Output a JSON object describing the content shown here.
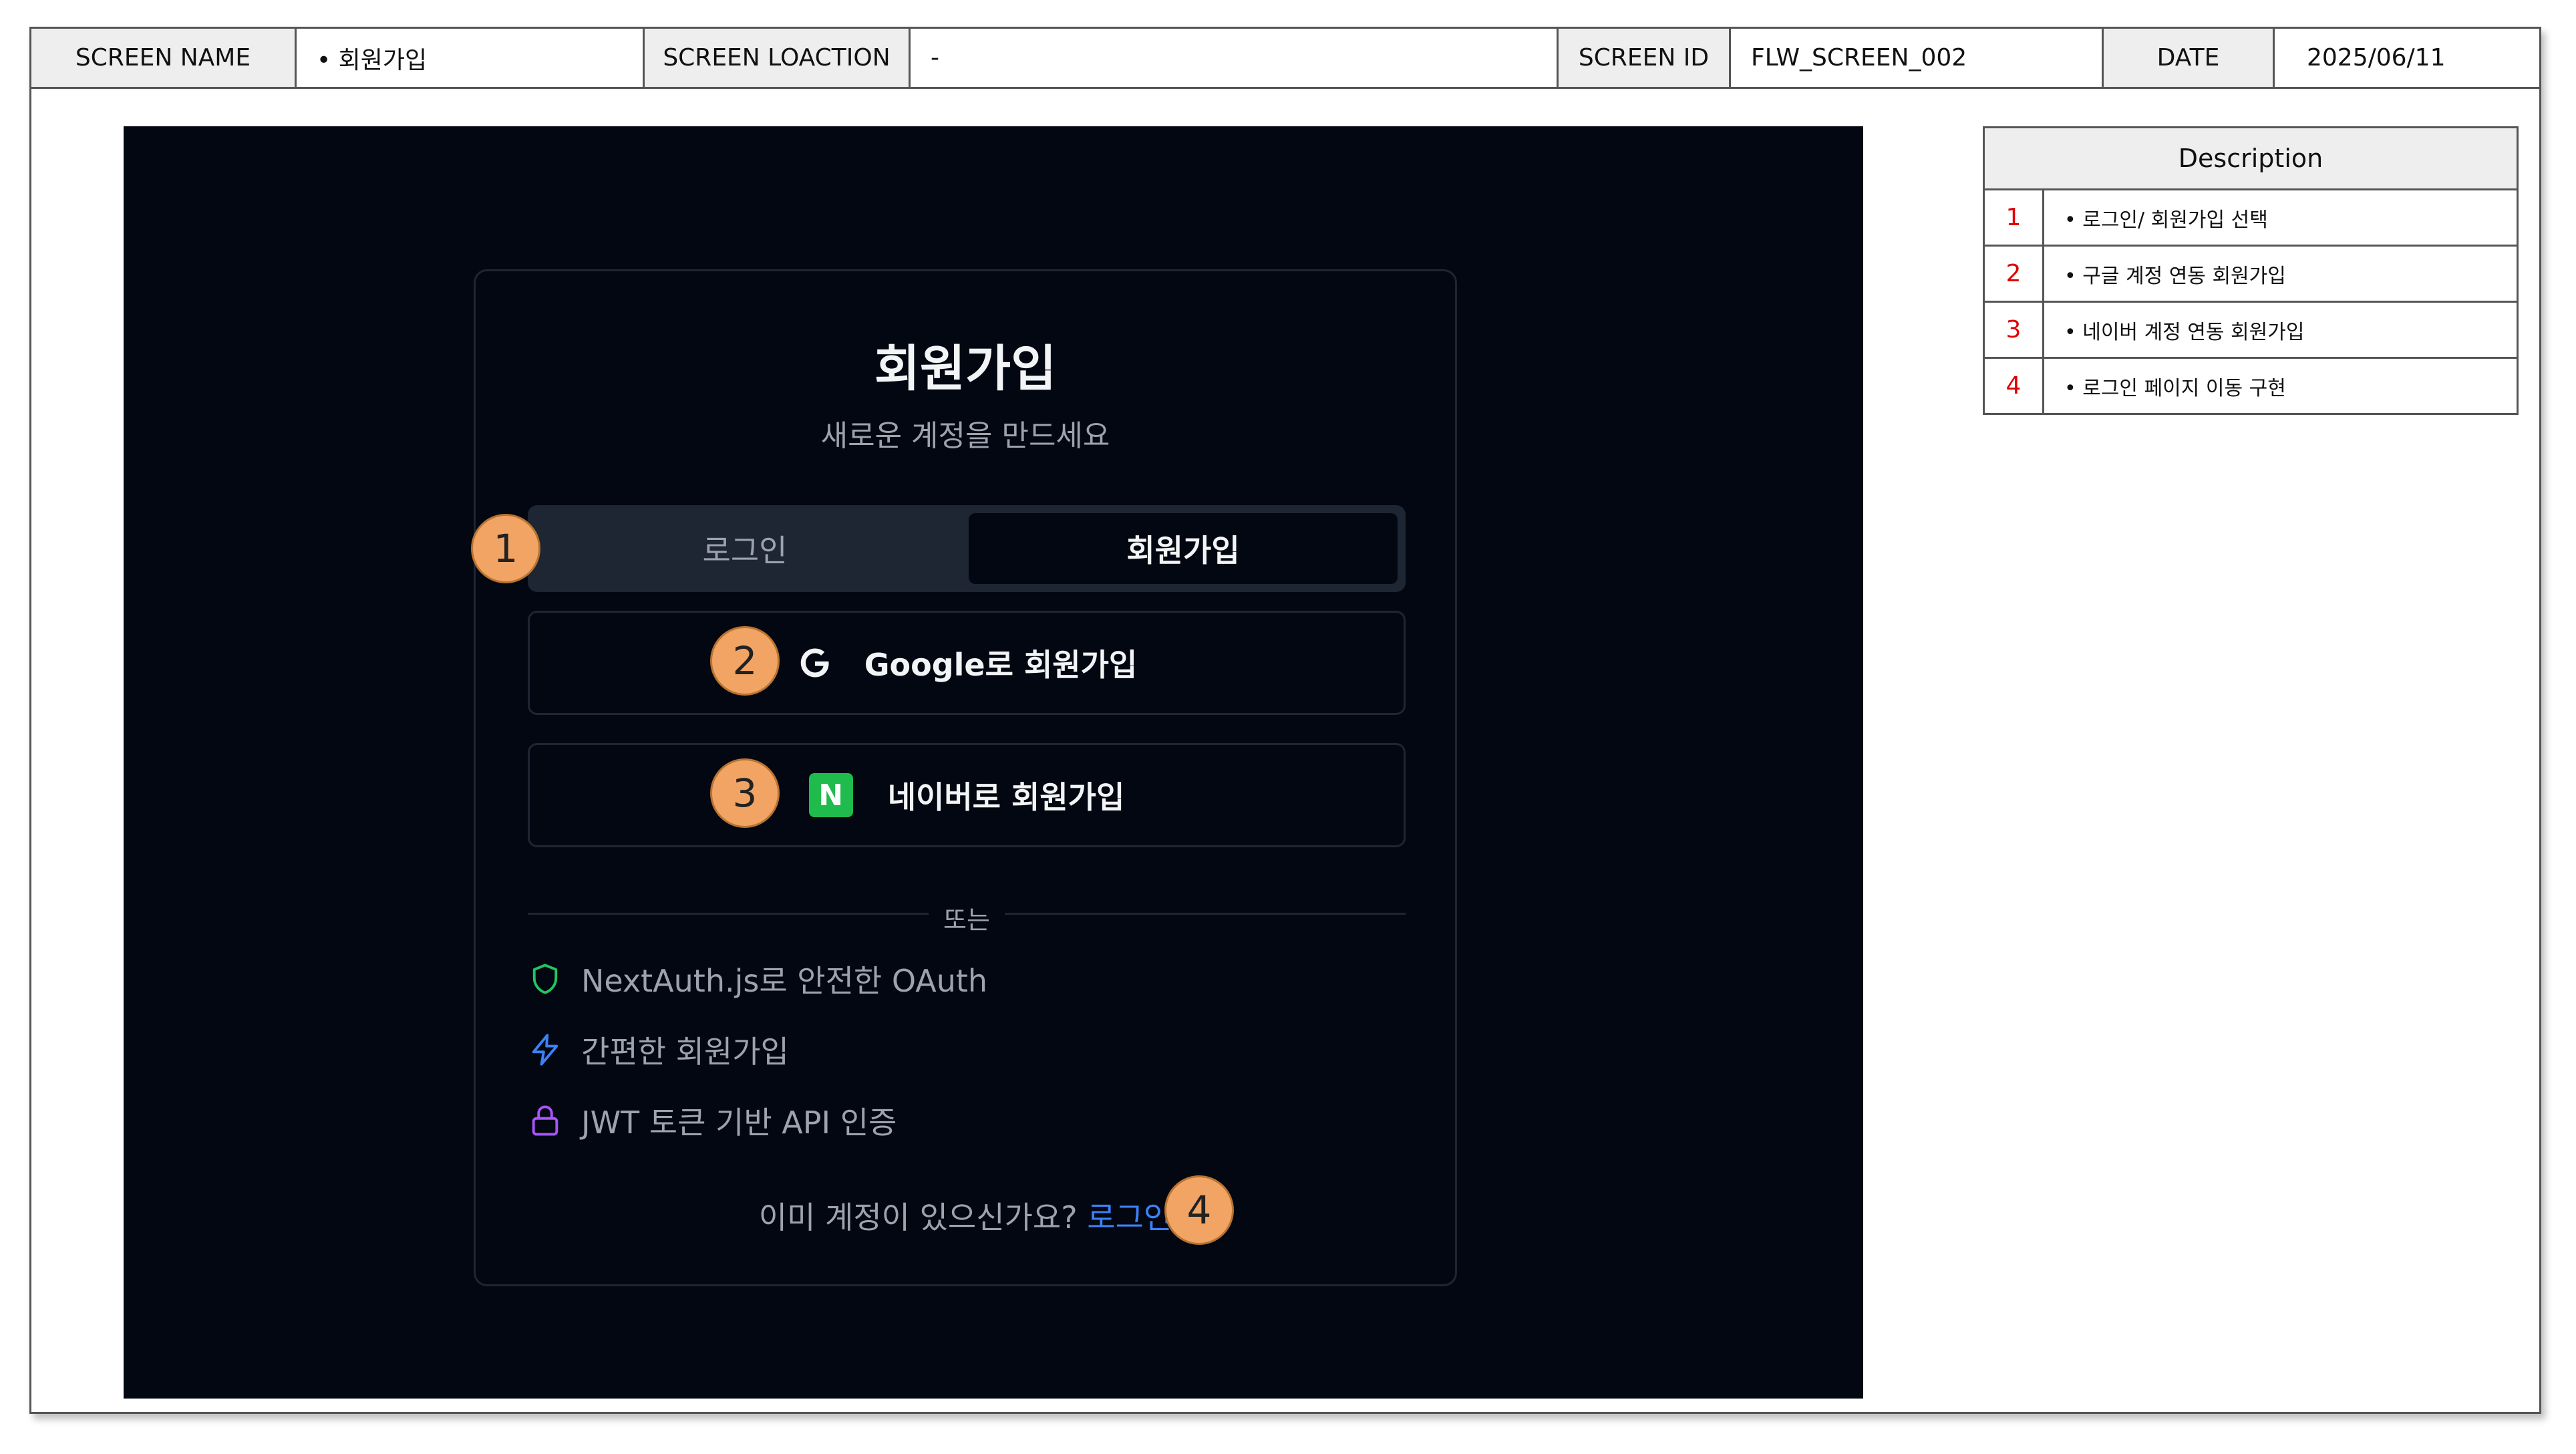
{
  "header": {
    "screen_name_label": "SCREEN NAME",
    "screen_name_value": "• 회원가입",
    "screen_location_label": "SCREEN LOACTION",
    "screen_location_value": "-",
    "screen_id_label": "SCREEN ID",
    "screen_id_value": "FLW_SCREEN_002",
    "date_label": "DATE",
    "date_value": "2025/06/11"
  },
  "app": {
    "title": "회원가입",
    "subtitle": "새로운 계정을 만드세요",
    "tabs": {
      "login": "로그인",
      "signup": "회원가입"
    },
    "google_button": "Google로 회원가입",
    "naver_icon_letter": "N",
    "naver_button": "네이버로 회원가입",
    "divider": "또는",
    "features": [
      {
        "icon": "shield-icon",
        "text": "NextAuth.js로 안전한 OAuth",
        "color": "#22c55e"
      },
      {
        "icon": "lightning-icon",
        "text": "간편한 회원가입",
        "color": "#3b82f6"
      },
      {
        "icon": "lock-icon",
        "text": "JWT 토큰 기반 API 인증",
        "color": "#a855f7"
      }
    ],
    "footer_text": "이미 계정이 있으신가요? ",
    "footer_link": "로그인"
  },
  "markers": [
    "1",
    "2",
    "3",
    "4"
  ],
  "description": {
    "title": "Description",
    "rows": [
      {
        "num": "1",
        "text": "•  로그인/ 회원가입 선택"
      },
      {
        "num": "2",
        "text": "•  구글 계정 연동 회원가입"
      },
      {
        "num": "3",
        "text": "•  네이버 계정 연동 회원가입"
      },
      {
        "num": "4",
        "text": "•  로그인 페이지 이동 구현"
      }
    ]
  },
  "colors": {
    "app_bg": "#030712",
    "marker": "#f2a465",
    "link": "#3b82f6",
    "naver_green": "#1fbb4c",
    "desc_number": "#e00000"
  }
}
